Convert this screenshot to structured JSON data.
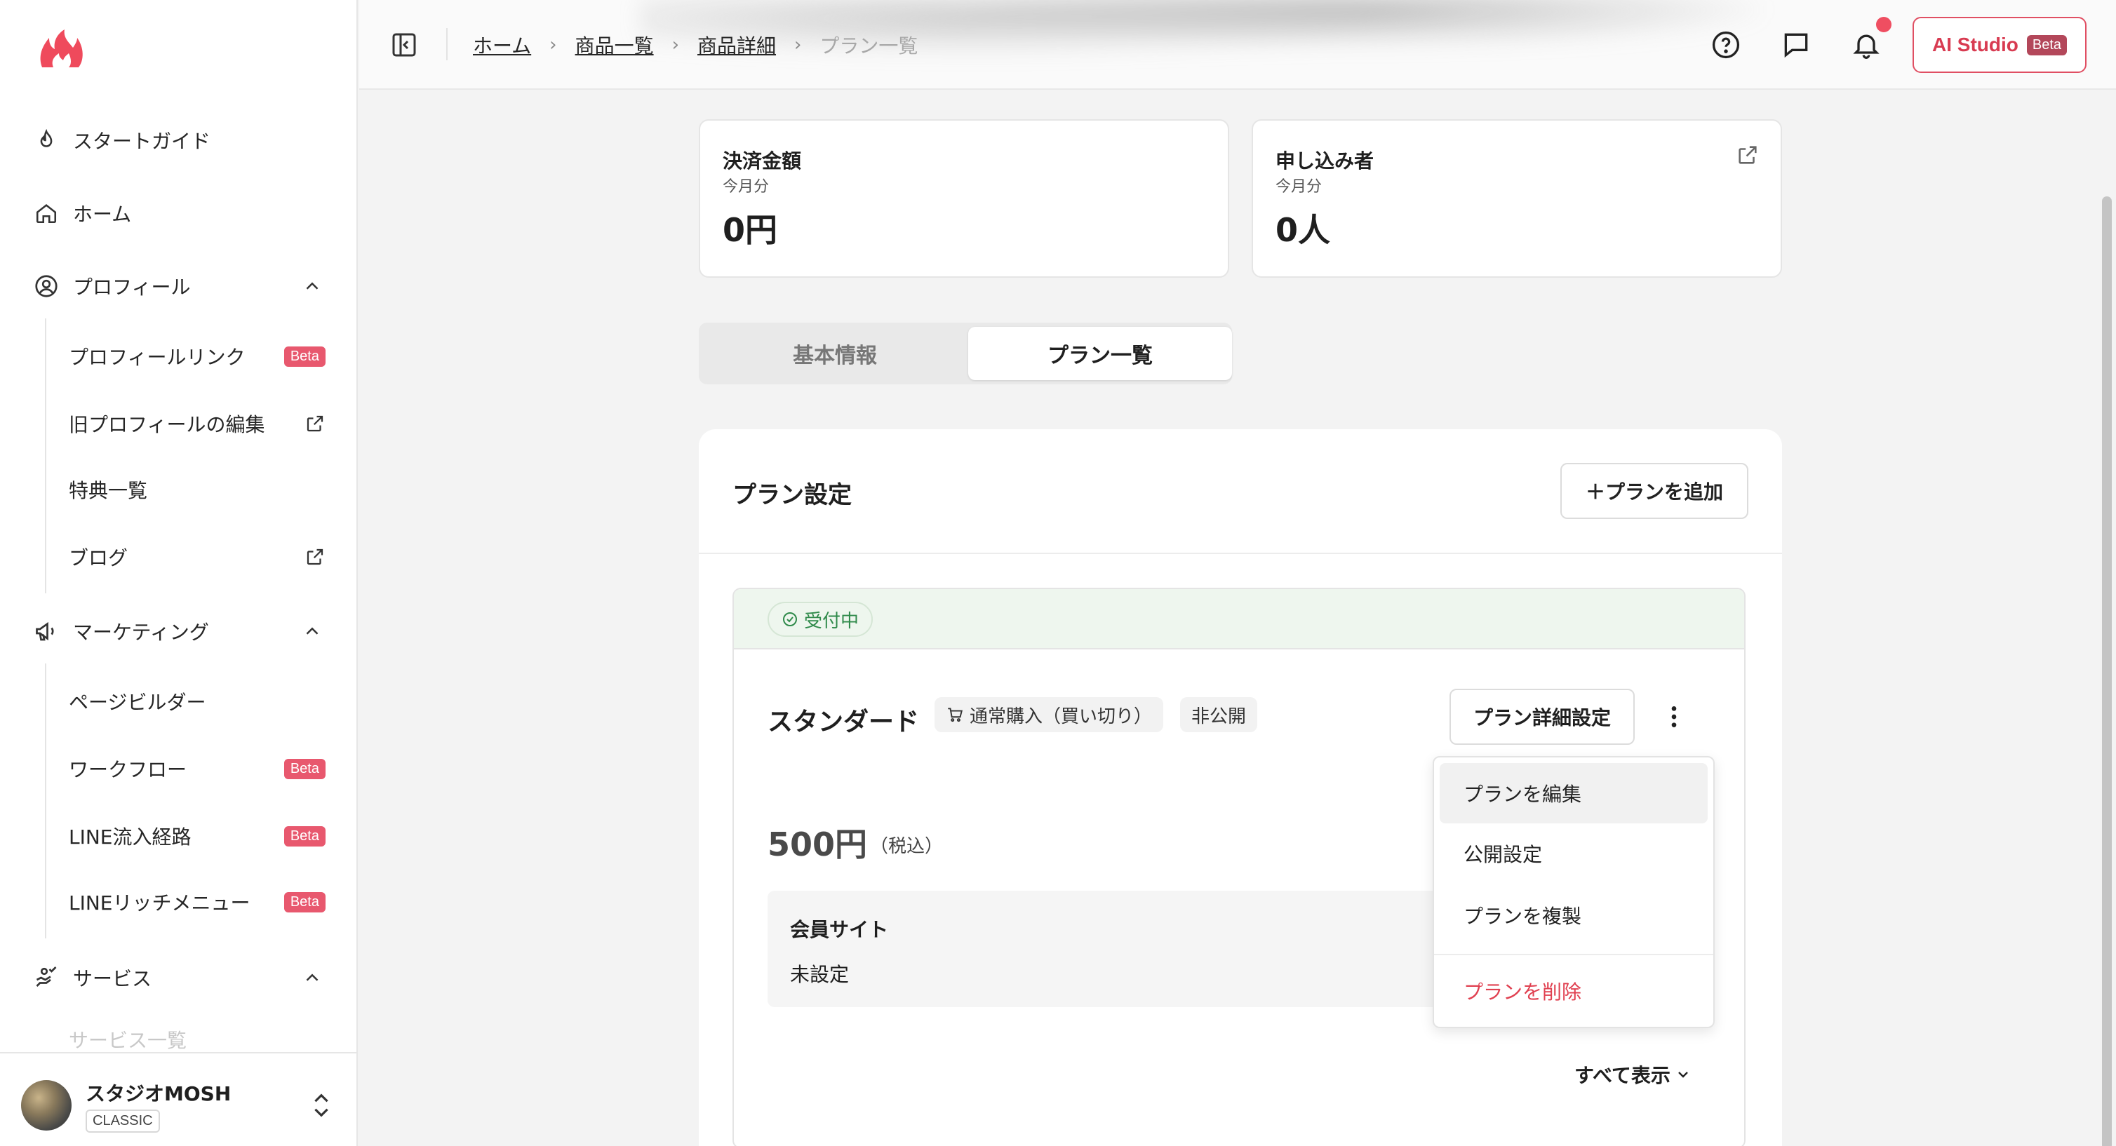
{
  "sidebar": {
    "nav": {
      "start_guide": "スタートガイド",
      "home": "ホーム",
      "profile": "プロフィール",
      "marketing": "マーケティング",
      "service": "サービス"
    },
    "profile_items": [
      {
        "label": "プロフィールリンク",
        "badge": "Beta"
      },
      {
        "label": "旧プロフィールの編集",
        "icon": "external-link-icon"
      },
      {
        "label": "特典一覧"
      },
      {
        "label": "ブログ",
        "icon": "external-link-icon"
      }
    ],
    "marketing_items": [
      {
        "label": "ページビルダー"
      },
      {
        "label": "ワークフロー",
        "badge": "Beta"
      },
      {
        "label": "LINE流入経路",
        "badge": "Beta"
      },
      {
        "label": "LINEリッチメニュー",
        "badge": "Beta"
      }
    ],
    "service_items": [
      {
        "label": "サービス一覧"
      }
    ],
    "footer": {
      "org_name": "スタジオMOSH",
      "plan_badge": "CLASSIC"
    }
  },
  "header": {
    "breadcrumb": [
      "ホーム",
      "商品一覧",
      "商品詳細",
      "プラン一覧"
    ],
    "ai_button": {
      "label": "AI Studio",
      "badge": "Beta"
    },
    "icons": [
      "help-icon",
      "chat-icon",
      "bell-icon"
    ]
  },
  "stats": {
    "payment": {
      "title": "決済金額",
      "period": "今月分",
      "value": "0円"
    },
    "applicants": {
      "title": "申し込み者",
      "period": "今月分",
      "value": "0人"
    }
  },
  "tabs": {
    "basic_info": "基本情報",
    "plan_list": "プラン一覧",
    "active": "plan_list"
  },
  "plan_settings": {
    "title": "プラン設定",
    "add_button": "＋プランを追加",
    "plan": {
      "status": "受付中",
      "name": "スタンダード",
      "purchase_type": "通常購入（買い切り）",
      "visibility": "非公開",
      "detail_button": "プラン詳細設定",
      "price": "500円",
      "tax_note": "（税込）",
      "member_site_label": "会員サイト",
      "member_site_value": "未設定",
      "show_all": "すべて表示"
    },
    "menu": {
      "edit": "プランを編集",
      "publish": "公開設定",
      "duplicate": "プランを複製",
      "delete": "プランを削除"
    }
  },
  "colors": {
    "accent": "#e04f63",
    "status_green": "#2f8a4a",
    "danger": "#e04050"
  }
}
